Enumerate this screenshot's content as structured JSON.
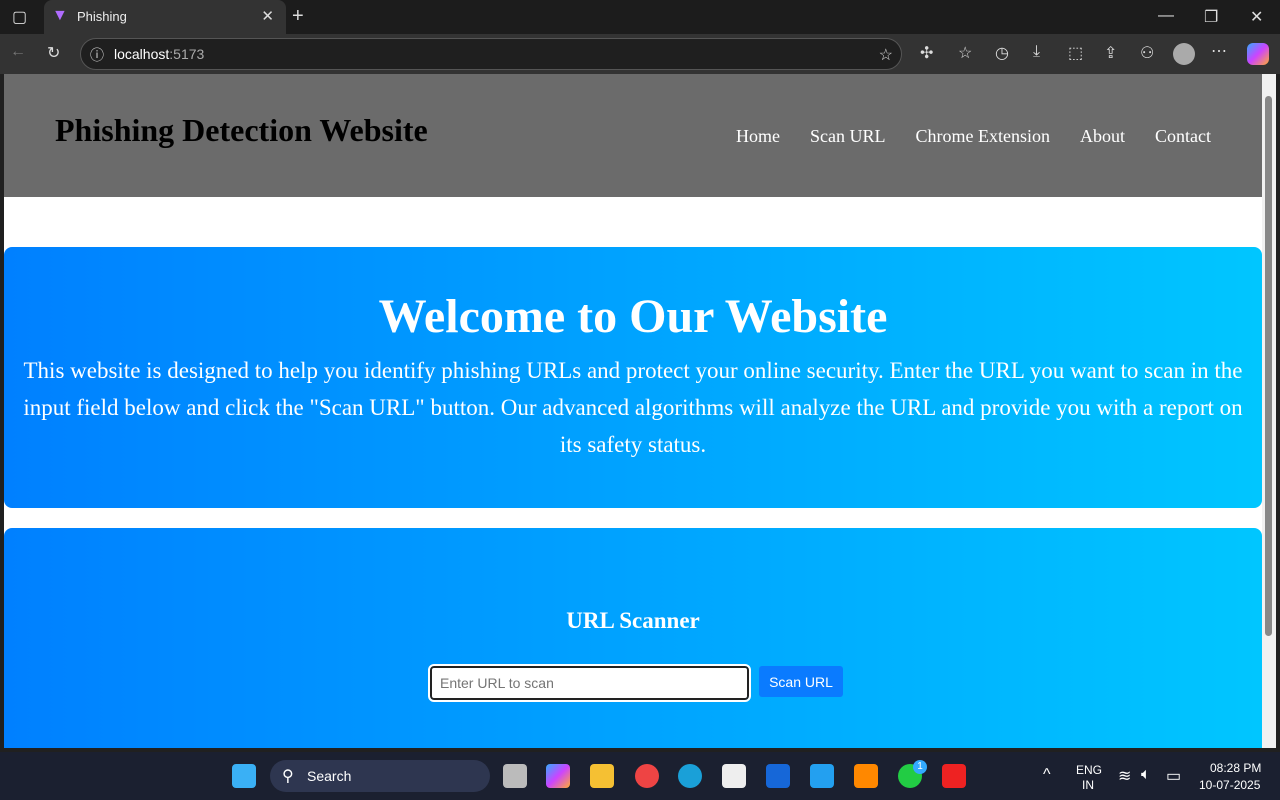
{
  "browser": {
    "tab_title": "Phishing",
    "url_host": "localhost",
    "url_port": ":5173"
  },
  "header": {
    "title": "Phishing Detection Website",
    "nav": [
      "Home",
      "Scan URL",
      "Chrome Extension",
      "About",
      "Contact"
    ]
  },
  "hero": {
    "title": "Welcome to Our Website",
    "text": "This website is designed to help you identify phishing URLs and protect your online security. Enter the URL you want to scan in the input field below and click the \"Scan URL\" button. Our advanced algorithms will analyze the URL and provide you with a report on its safety status."
  },
  "scanner": {
    "title": "URL Scanner",
    "placeholder": "Enter URL to scan",
    "button": "Scan URL"
  },
  "taskbar": {
    "search": "Search",
    "lang1": "ENG",
    "lang2": "IN",
    "time": "08:28 PM",
    "date": "10-07-2025",
    "whatsapp_badge": "1"
  },
  "colors": {
    "gradient_start": "#0080ff",
    "gradient_end": "#00c6ff",
    "header_bg": "#6b6b6b",
    "button": "#0a7bff"
  }
}
